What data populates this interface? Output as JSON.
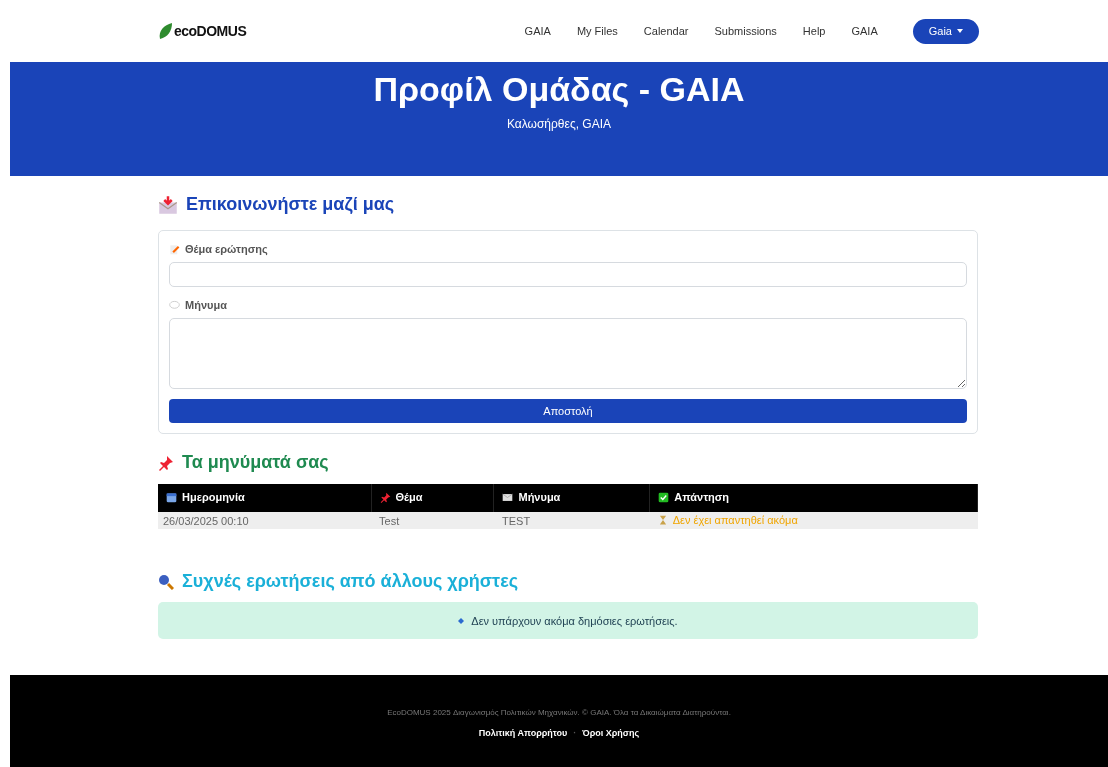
{
  "navbar": {
    "logo": "ecoDOMUS",
    "links": [
      {
        "label": "GAIA"
      },
      {
        "label": "My Files"
      },
      {
        "label": "Calendar"
      },
      {
        "label": "Submissions"
      },
      {
        "label": "Help"
      },
      {
        "label": "GAIA"
      }
    ],
    "user_menu": "Gaia"
  },
  "banner": {
    "title": "Προφίλ Ομάδας - GAIA",
    "subtitle": "Καλωσήρθες, GAIA"
  },
  "contact": {
    "heading": "Επικοινωνήστε μαζί μας",
    "subject_label": "Θέμα ερώτησης",
    "message_label": "Μήνυμα",
    "submit": "Αποστολή"
  },
  "messages": {
    "heading": "Τα μηνύματά σας",
    "columns": [
      {
        "label": "Ημερομηνία",
        "kind": "calendar"
      },
      {
        "label": "Θέμα",
        "kind": "pin"
      },
      {
        "label": "Μήνυμα",
        "kind": "envelope"
      },
      {
        "label": "Απάντηση",
        "kind": "check"
      }
    ],
    "rows": [
      {
        "date": "26/03/2025 00:10",
        "subject": "Test",
        "message": "TEST",
        "answer": "Δεν έχει απαντηθεί ακόμα",
        "answered": false
      }
    ]
  },
  "faq": {
    "heading": "Συχνές ερωτήσεις από άλλους χρήστες",
    "notice": "Δεν υπάρχουν ακόμα δημόσιες ερωτήσεις."
  },
  "footer": {
    "text": "EcoDOMUS 2025 Διαγωνισμός Πολιτικών Μηχανικών. © GAIA. Όλα τα Δικαιώματα Διατηρούνται.",
    "links": [
      "Πολιτική Απορρήτου",
      "Όροι Χρήσης"
    ],
    "separator": "·"
  }
}
